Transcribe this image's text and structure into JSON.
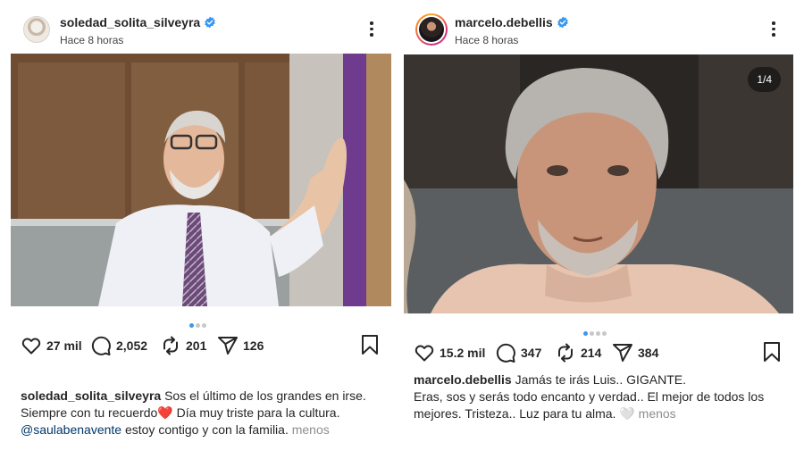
{
  "posts": [
    {
      "username": "soledad_solita_silveyra",
      "time": "Hace 8 horas",
      "likes": "27 mil",
      "comments": "2,052",
      "reposts": "201",
      "shares": "126",
      "caption_user": "soledad_solita_silveyra",
      "caption_line1": "Sos el último de los grandes en irse.",
      "caption_line2": "Siempre con tu recuerdo",
      "caption_emoji": "❤️",
      "caption_line2b": " Día muy triste para la cultura.",
      "caption_mention": "@saulabenavente",
      "caption_line3": " estoy contigo y con la familia.",
      "less_label": "menos"
    },
    {
      "username": "marcelo.debellis",
      "time": "Hace 8 horas",
      "counter": "1/4",
      "likes": "15.2 mil",
      "comments": "347",
      "reposts": "214",
      "shares": "384",
      "caption_user": "marcelo.debellis",
      "caption_line1": "Jamás te irás Luis.. GIGANTE.",
      "caption_line2": "Eras, sos y serás todo encanto y verdad.. El mejor de todos los",
      "caption_line3": "mejores. Tristeza.. Luz para tu alma.",
      "caption_emoji": "🤍",
      "less_label": "menos"
    }
  ],
  "colors": {
    "verified": "#3897f0",
    "mention": "#00376b",
    "muted": "#8e8e8e"
  },
  "icons": [
    "verified-badge-icon",
    "more-options-icon",
    "heart-icon",
    "comment-icon",
    "repost-icon",
    "send-icon",
    "bookmark-icon"
  ]
}
